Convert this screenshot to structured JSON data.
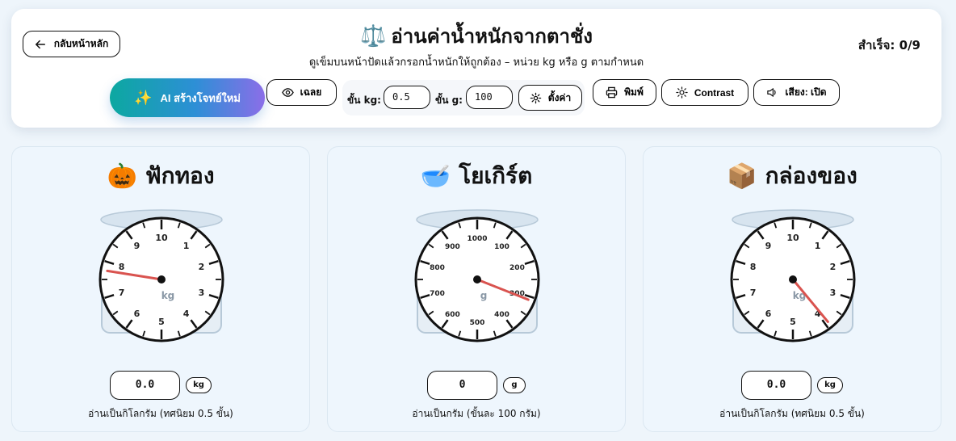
{
  "header": {
    "back_label": "กลับหน้าหลัก",
    "title_emoji": "⚖️",
    "title": "อ่านค่าน้ำหนักจากตาชั่ง",
    "subtitle": "ดูเข็มบนหน้าปัดแล้วกรอกน้ำหนักให้ถูกต้อง – หน่วย kg หรือ g ตามกำหนด",
    "score": "สำเร็จ: 0/9"
  },
  "toolbar": {
    "ai_label": "AI สร้างโจทย์ใหม่",
    "ai_icon": "sparkles-icon",
    "answer_label": "เฉลย",
    "kg_step_label": "ขั้น kg:",
    "kg_step_value": "0.5",
    "g_step_label": "ขั้น g:",
    "g_step_value": "100",
    "settings_label": "ตั้งค่า",
    "print_label": "พิมพ์",
    "contrast_label": "Contrast",
    "sound_label": "เสียง: เปิด"
  },
  "cards": [
    {
      "emoji": "🎃",
      "name": "ฟักทอง",
      "unit": "kg",
      "dial_labels": [
        "10",
        "1",
        "2",
        "3",
        "4",
        "5",
        "6",
        "7",
        "8",
        "9"
      ],
      "needle_value": 7.75,
      "max_value": 10,
      "answer": "0.0",
      "hint": "อ่านเป็นกิโลกรัม (ทศนิยม 0.5 ขั้น)"
    },
    {
      "emoji": "🥣",
      "name": "โยเกิร์ต",
      "unit": "g",
      "dial_labels": [
        "1000",
        "100",
        "200",
        "300",
        "400",
        "500",
        "600",
        "700",
        "800",
        "900"
      ],
      "needle_value": 310,
      "max_value": 1000,
      "answer": "0",
      "hint": "อ่านเป็นกรัม (ขั้นละ 100 กรัม)"
    },
    {
      "emoji": "📦",
      "name": "กล่องของ",
      "unit": "kg",
      "dial_labels": [
        "10",
        "1",
        "2",
        "3",
        "4",
        "5",
        "6",
        "7",
        "8",
        "9"
      ],
      "needle_value": 3.9,
      "max_value": 10,
      "answer": "0.0",
      "hint": "อ่านเป็นกิโลกรัม (ทศนิยม 0.5 ขั้น)"
    }
  ],
  "colors": {
    "needle": "#d9534f",
    "dial_face": "#ffffff",
    "dial_stroke": "#111111",
    "scale_plate": "#d7e4ef"
  }
}
